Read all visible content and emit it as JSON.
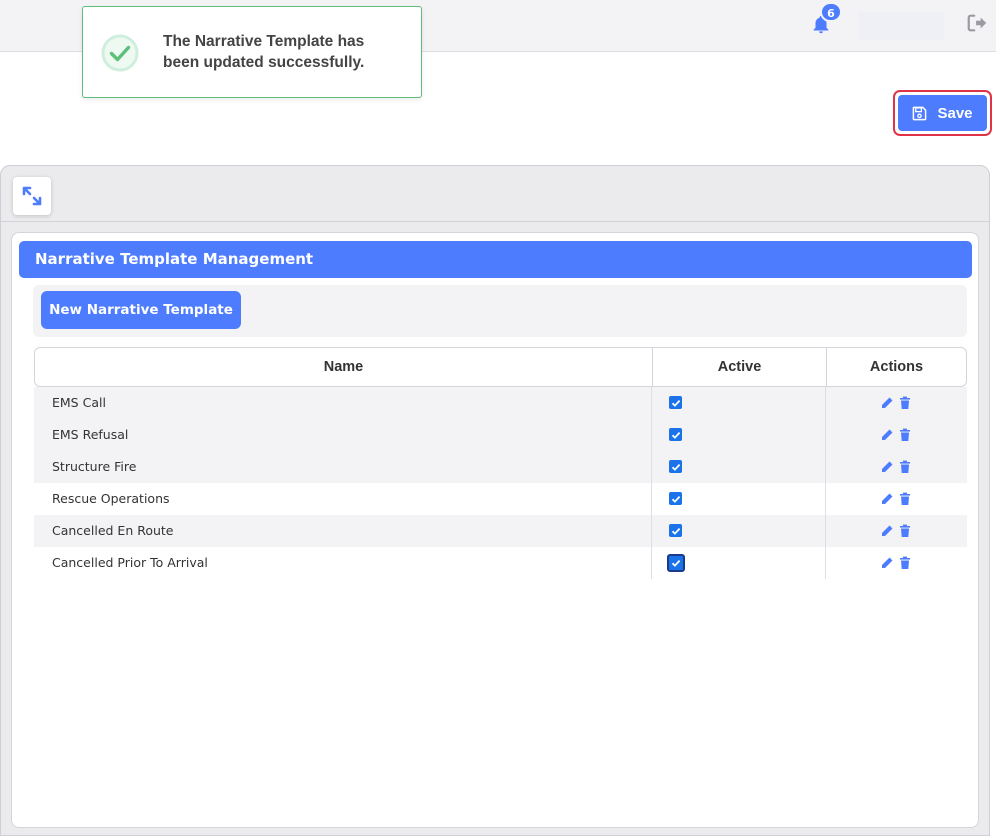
{
  "topbar": {
    "notification_count": "6",
    "bell_icon": "bell-icon",
    "logout_icon": "logout-icon"
  },
  "toast": {
    "message": "The Narrative Template has been updated successfully.",
    "icon": "check-circle-icon"
  },
  "actions": {
    "save_label": "Save",
    "save_icon": "floppy-disk-icon"
  },
  "panel": {
    "expand_icon": "expand-arrows-icon",
    "title": "Narrative Template Management",
    "new_button_label": "New Narrative Template"
  },
  "table": {
    "columns": [
      "Name",
      "Active",
      "Actions"
    ],
    "rows": [
      {
        "name": "EMS Call",
        "active": true
      },
      {
        "name": "EMS Refusal",
        "active": true
      },
      {
        "name": "Structure Fire",
        "active": true
      },
      {
        "name": "Rescue Operations",
        "active": true
      },
      {
        "name": "Cancelled En Route",
        "active": true
      },
      {
        "name": "Cancelled Prior To Arrival",
        "active": true
      }
    ],
    "row_icons": [
      "pencil-icon",
      "trash-icon"
    ]
  },
  "colors": {
    "primary": "#4d7cfe",
    "success": "#5cbf7a",
    "checkbox": "#1a73e8",
    "highlight_border": "#e0334a"
  }
}
